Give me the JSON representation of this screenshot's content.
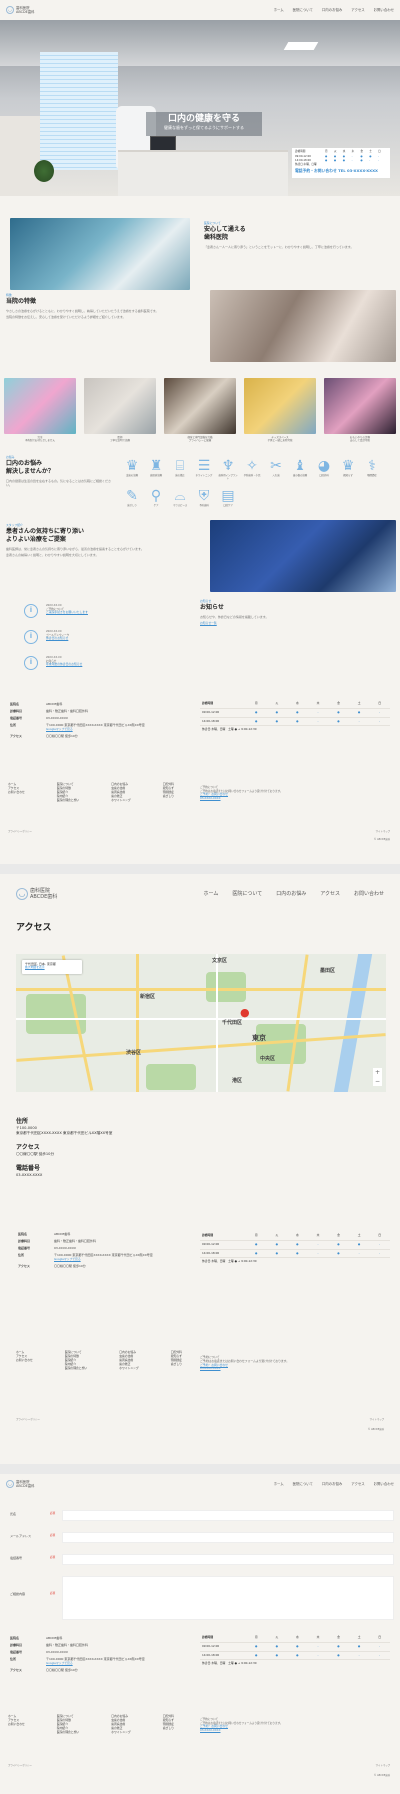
{
  "logo": {
    "line1": "歯科医院",
    "line2": "ABCDE歯科"
  },
  "nav": [
    "ホーム",
    "医院について",
    "口内のお悩み",
    "アクセス",
    "お問い合わせ"
  ],
  "hero": {
    "title": "口内の健康を守る",
    "subtitle": "健康な歯をずっと保てるようにサポートする"
  },
  "hours_card": {
    "title": "診療時間",
    "days": [
      "月",
      "火",
      "水",
      "木",
      "金",
      "土",
      "日"
    ],
    "rows": [
      {
        "time": "09:00-12:00",
        "marks": [
          "●",
          "●",
          "●",
          "-",
          "●",
          "●",
          "-"
        ]
      },
      {
        "time": "14:00-18:00",
        "marks": [
          "●",
          "●",
          "●",
          "-",
          "●",
          "-",
          "-"
        ]
      }
    ],
    "note": "休診日:木曜、日曜",
    "tel": "電話予約・お問い合わせ TEL 03-XXXX-XXXX"
  },
  "about": {
    "tag": "医院について",
    "title": "安心して通える\n歯科医院",
    "text": "「患者さん一人一人に寄り添う」ということをモットーに、わかりやすく説明し、丁寧に治療を行っています。"
  },
  "features": {
    "tag": "特徴",
    "title": "当院の特徴",
    "text1": "やさしさの治療を心がけるとともに、わかりやすく説明し、納得していただいたうえで治療をする歯科医院です。",
    "text2": "当院の特徴をお伝えし、安心して治療を受けていただけるよう詳細をご紹介しています。",
    "items": [
      "完全\n予約制でお待たせしません",
      "医師\n丁寧な説明で治療",
      "個室と専門設備を完備\nプライバシーに配慮",
      "キッズスペース\n子供と一緒に来院可能",
      "おもいやりの診療\n安心して受診可能"
    ]
  },
  "troubles": {
    "tag": "お悩み",
    "title": "口内のお悩み\n解決しませんか？",
    "text": "口内の健康は生活の質を左右するもの。気になることはお気軽にご相談ください。",
    "icons": [
      "虫歯の治療",
      "歯周病治療",
      "歯の矯正",
      "ホワイトニング",
      "歯科用インプラント",
      "予防歯科・小児",
      "入れ歯",
      "歯の根の治療",
      "口腔外科",
      "親知らず",
      "顎関節症",
      "歯ぎしり",
      "ケア",
      "マウスピース",
      "予防歯科",
      "口腔ケア"
    ]
  },
  "staff": {
    "tag": "スタッフ紹介",
    "title": "患者さんの気持ちに寄り添い\nよりよい治療をご提案",
    "text1": "歯科医師は、常に患者さんの気持ちに寄り添いながら、最善の治療を提案することを心がけています。",
    "text2": "患者さんの納得いく説明と、わかりやすい説明を大切にしています。"
  },
  "news": {
    "items": [
      {
        "date": "20XX.XX.XX",
        "title": "ご予約について",
        "link": "ご来院手続きをお願いいたします"
      },
      {
        "date": "20XX.XX.XX",
        "title": "ゴールデンウィーク",
        "link": "休診日のお知らせ"
      },
      {
        "date": "20XX.XX.XX",
        "title": "お知らせ",
        "link": "年末年始の休診日のお知らせ"
      }
    ],
    "tag": "お知らせ",
    "title": "お知らせ",
    "text": "お知らせや、休診日などの情報を掲載しています。",
    "more": "お知らせ一覧"
  },
  "clinic_info": {
    "name_label": "医院名",
    "name": "ABCDE歯科",
    "dept_label": "診療科目",
    "dept": "歯科・矯正歯科・歯科口腔外科",
    "tel_label": "電話番号",
    "tel": "03-XXXX-XXXX",
    "addr_label": "住所",
    "addr": "〒100-0000 東京都千代田区XXXX-XXXX 東京都千代田ビルXX階XX号室",
    "map_link": "Googleマップで見る",
    "access_label": "アクセス",
    "access": "〇〇線〇〇駅 徒歩10分"
  },
  "schedule": {
    "title": "診療時間",
    "days": [
      "月",
      "火",
      "水",
      "木",
      "金",
      "土",
      "日"
    ],
    "rows": [
      {
        "time": "09:00-12:00",
        "marks": [
          "●",
          "●",
          "●",
          "-",
          "●",
          "●",
          "-"
        ]
      },
      {
        "time": "14:00-18:00",
        "marks": [
          "●",
          "●",
          "●",
          "-",
          "●",
          "-",
          "-"
        ]
      }
    ],
    "note": "休診日:木曜、日曜　土曜 ● → 9:00-12:30"
  },
  "footer": {
    "col1": [
      "ホーム",
      "アクセス",
      "お問い合わせ"
    ],
    "col2": [
      "医院について",
      "医院の特徴",
      "医院紹介",
      "院内紹介",
      "医院の理念と想い"
    ],
    "col3": [
      "口内のお悩み",
      "虫歯の治療",
      "歯周病治療",
      "歯の矯正",
      "ホワイトニング",
      "歯科用インプラント",
      "予防歯科・小児",
      "入れ歯"
    ],
    "col4": [
      "口腔外科",
      "親知らず",
      "顎関節症",
      "歯ぎしり",
      "マウスピース",
      "予防歯科",
      "口腔ケア"
    ],
    "contact_title": "ご予約について",
    "contact_text": "ご予約はお電話またはお問い合わせフォームより受け付けております。",
    "contact_link": "ご予約・お問い合わせ",
    "contact_tel": "03-XXXX-XXXX",
    "policy": "プライバシーポリシー",
    "sitemap": "サイトマップ",
    "copyright": "© ABCDE歯科"
  },
  "access_page": {
    "title": "アクセス",
    "map_card": "千代田区, 日本, 東京都",
    "map_card_link": "拡大地図を表示",
    "map_labels": [
      "文京区",
      "墨田区",
      "新宿区",
      "千代田区",
      "東京",
      "渋谷区",
      "中央区",
      "港区"
    ],
    "addr_title": "住所",
    "addr_zip": "〒100-0000",
    "addr_text": "東京都千代田区XXXX-XXXX 東京都千代田ビルXX階XX号室",
    "access_title": "アクセス",
    "access_text": "〇〇線〇〇駅 徒歩10分",
    "tel_title": "電話番号",
    "tel_text": "03-XXXX-XXXX"
  },
  "contact_form": {
    "fields": [
      {
        "label": "氏名",
        "required": "必須"
      },
      {
        "label": "メールアドレス",
        "required": "必須"
      },
      {
        "label": "電話番号",
        "required": "必須"
      },
      {
        "label": "ご相談内容",
        "required": "必須"
      }
    ]
  }
}
